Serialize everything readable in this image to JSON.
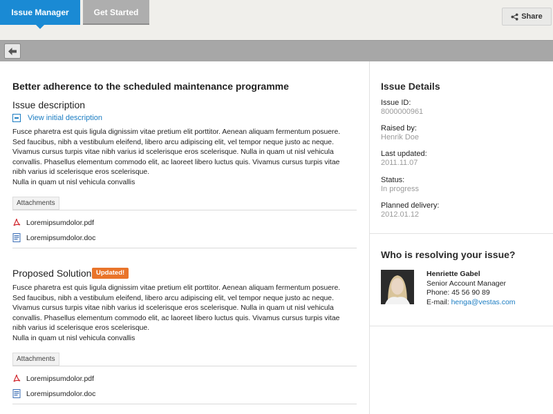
{
  "tabs": [
    {
      "label": "Issue Manager",
      "active": true
    },
    {
      "label": "Get Started",
      "active": false
    }
  ],
  "share": {
    "label": "Share",
    "icon": "share-icon"
  },
  "toolbar": {
    "back_icon": "back-arrow-icon"
  },
  "issue": {
    "title": "Better adherence to the scheduled maintenance programme",
    "description_heading": "Issue description",
    "view_initial_label": "View initial description",
    "description_lines": [
      "Fusce pharetra est quis ligula dignissim vitae pretium elit porttitor. Aenean aliquam fermentum posuere.",
      "Sed faucibus, nibh a vestibulum eleifend, libero arcu adipiscing elit, vel tempor neque justo ac neque.",
      "Vivamus cursus turpis vitae nibh varius id scelerisque eros scelerisque. Nulla in quam ut nisl vehicula",
      "convallis. Phasellus elementum commodo elit, ac laoreet libero luctus quis. Vivamus cursus turpis vitae",
      "nibh varius id scelerisque eros scelerisque.",
      "Nulla in quam ut nisl vehicula convallis"
    ],
    "attachments_label": "Attachments",
    "attachments": [
      {
        "name": "Loremipsumdolor.pdf",
        "icon": "pdf-icon"
      },
      {
        "name": "Loremipsumdolor.doc",
        "icon": "doc-icon"
      }
    ],
    "solution_heading": "Proposed Solution",
    "updated_badge": "Updated!",
    "solution_lines": [
      "Fusce pharetra est quis ligula dignissim vitae pretium elit porttitor. Aenean aliquam fermentum posuere.",
      "Sed faucibus, nibh a vestibulum eleifend, libero arcu adipiscing elit, vel tempor neque justo ac neque.",
      "Vivamus cursus turpis vitae nibh varius id scelerisque eros scelerisque. Nulla in quam ut nisl vehicula",
      "convallis. Phasellus elementum commodo elit, ac laoreet libero luctus quis. Vivamus cursus turpis vitae",
      "nibh varius id scelerisque eros scelerisque.",
      "Nulla in quam ut nisl vehicula convallis"
    ],
    "solution_attachments_label": "Attachments",
    "solution_attachments": [
      {
        "name": "Loremipsumdolor.pdf",
        "icon": "pdf-icon"
      },
      {
        "name": "Loremipsumdolor.doc",
        "icon": "doc-icon"
      }
    ]
  },
  "details": {
    "title": "Issue Details",
    "fields": [
      {
        "label": "Issue ID:",
        "value": "8000000961"
      },
      {
        "label": "Raised by:",
        "value": "Henrik Doe"
      },
      {
        "label": "Last updated:",
        "value": "2011.11.07"
      },
      {
        "label": "Status:",
        "value": "In progress"
      },
      {
        "label": "Planned delivery:",
        "value": "2012.01.12"
      }
    ]
  },
  "resolver": {
    "title": "Who is resolving your issue?",
    "name": "Henriette Gabel",
    "role": "Senior Account Manager",
    "phone": "Phone: 45 56 90 89",
    "email_prefix": "E-mail: ",
    "email": "henga@vestas.com"
  },
  "colors": {
    "accent": "#1a8ad4",
    "badge": "#e9742a",
    "toolbar": "#a7a7a7",
    "link": "#1a7cc2"
  }
}
